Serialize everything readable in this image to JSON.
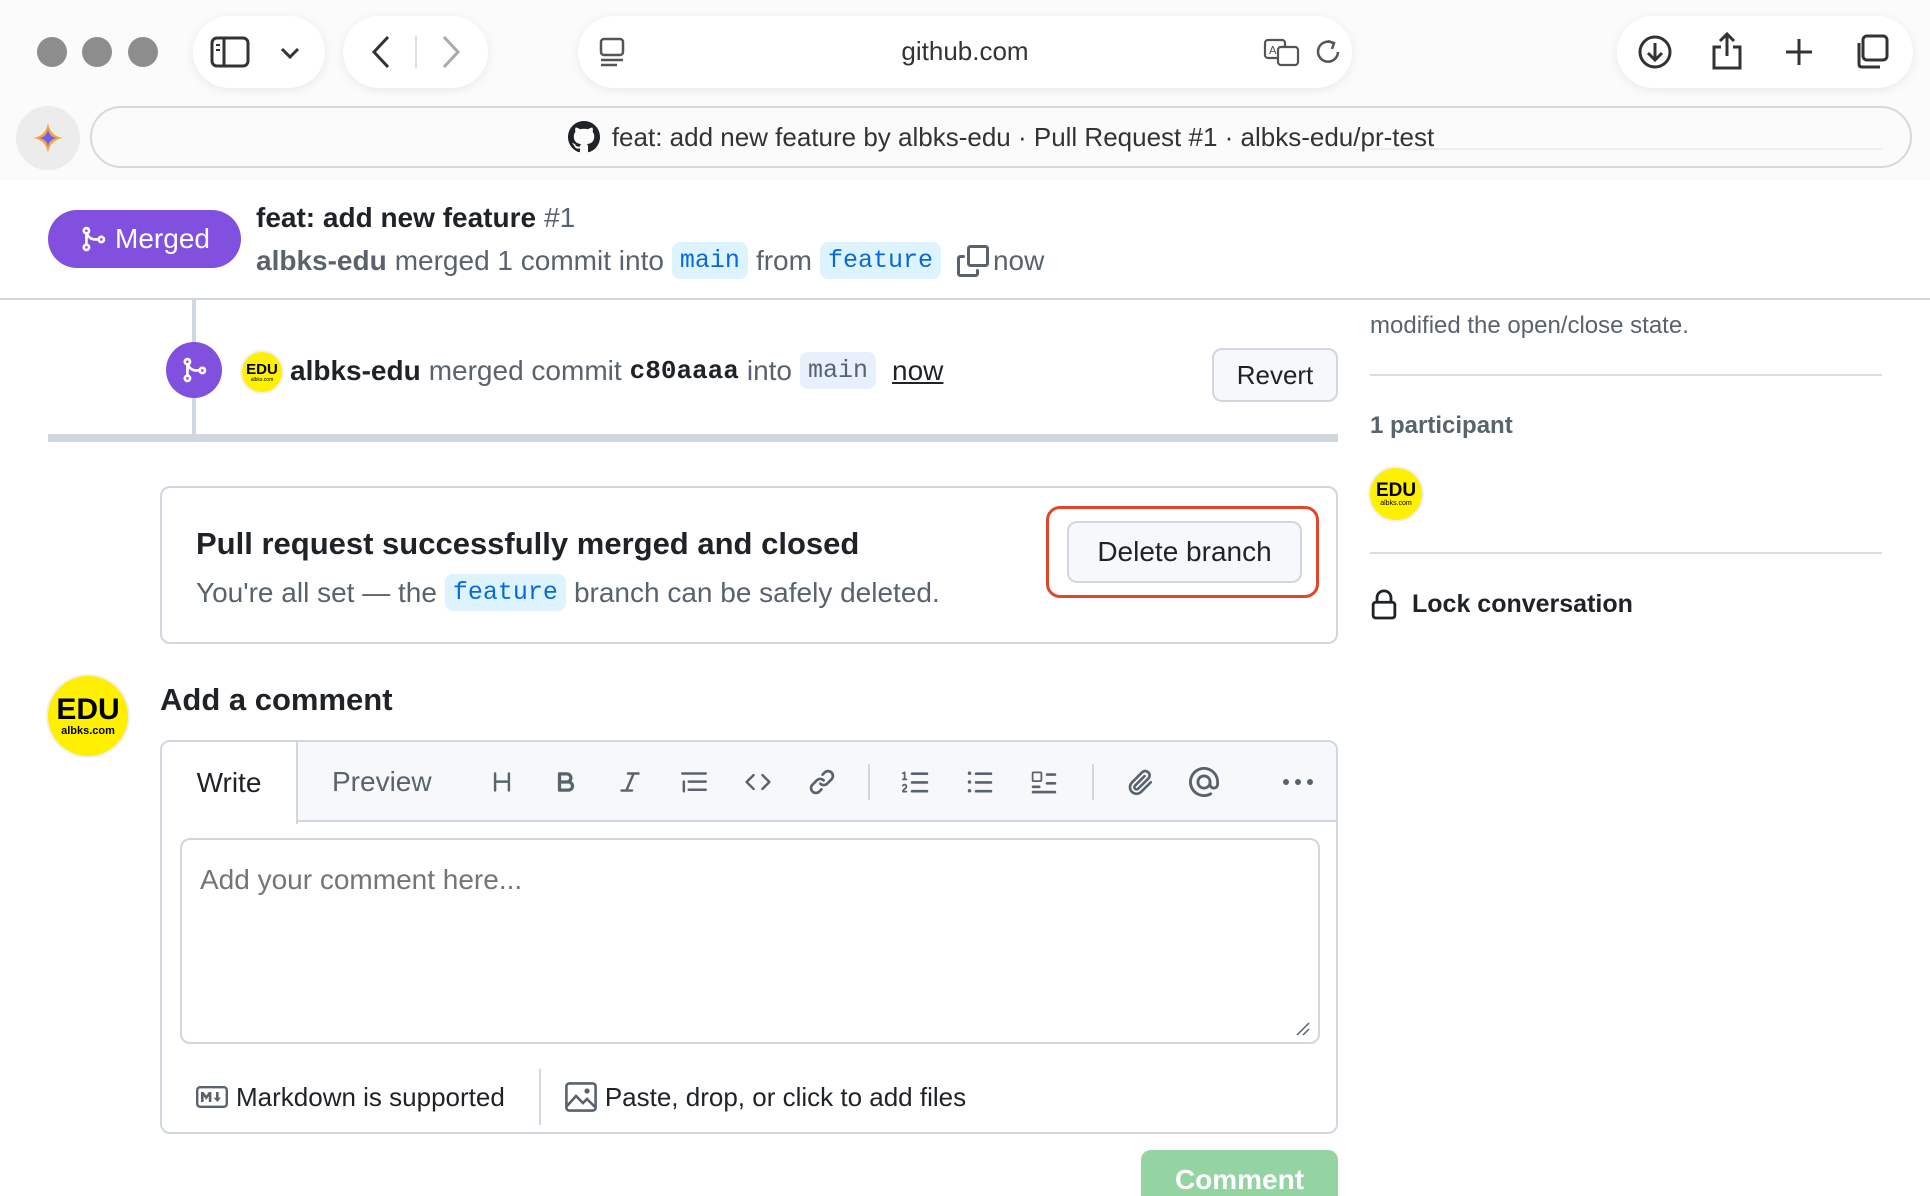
{
  "browser": {
    "url": "github.com",
    "tab_title": "feat: add new feature by albks-edu · Pull Request #1 · albks-edu/pr-test"
  },
  "pr": {
    "status": "Merged",
    "title": "feat: add new feature",
    "number": "#1",
    "author": "albks-edu",
    "merged_text": "merged 1 commit into",
    "base_branch": "main",
    "from_text": "from",
    "head_branch": "feature",
    "time": "now"
  },
  "event": {
    "user": "albks-edu",
    "action": "merged commit",
    "sha": "c80aaaa",
    "into": "into",
    "branch": "main",
    "time": "now",
    "revert_label": "Revert"
  },
  "merged_box": {
    "title": "Pull request successfully merged and closed",
    "desc_before": "You're all set — the",
    "branch": "feature",
    "desc_after": "branch can be safely deleted.",
    "delete_label": "Delete branch"
  },
  "comment": {
    "heading": "Add a comment",
    "tab_write": "Write",
    "tab_preview": "Preview",
    "placeholder": "Add your comment here...",
    "markdown_note": "Markdown is supported",
    "files_note": "Paste, drop, or click to add files",
    "submit_label": "Comment"
  },
  "avatar": {
    "line1": "EDU",
    "line2": "albks.com"
  },
  "sidebar": {
    "state_note": "modified the open/close state.",
    "participants_heading": "1 participant",
    "lock_label": "Lock conversation"
  },
  "colors": {
    "merged_purple": "#8250df",
    "branch_blue": "#0969da",
    "highlight_red": "#e0472a",
    "comment_green": "#94d3a2",
    "avatar_yellow": "#ffef00"
  }
}
